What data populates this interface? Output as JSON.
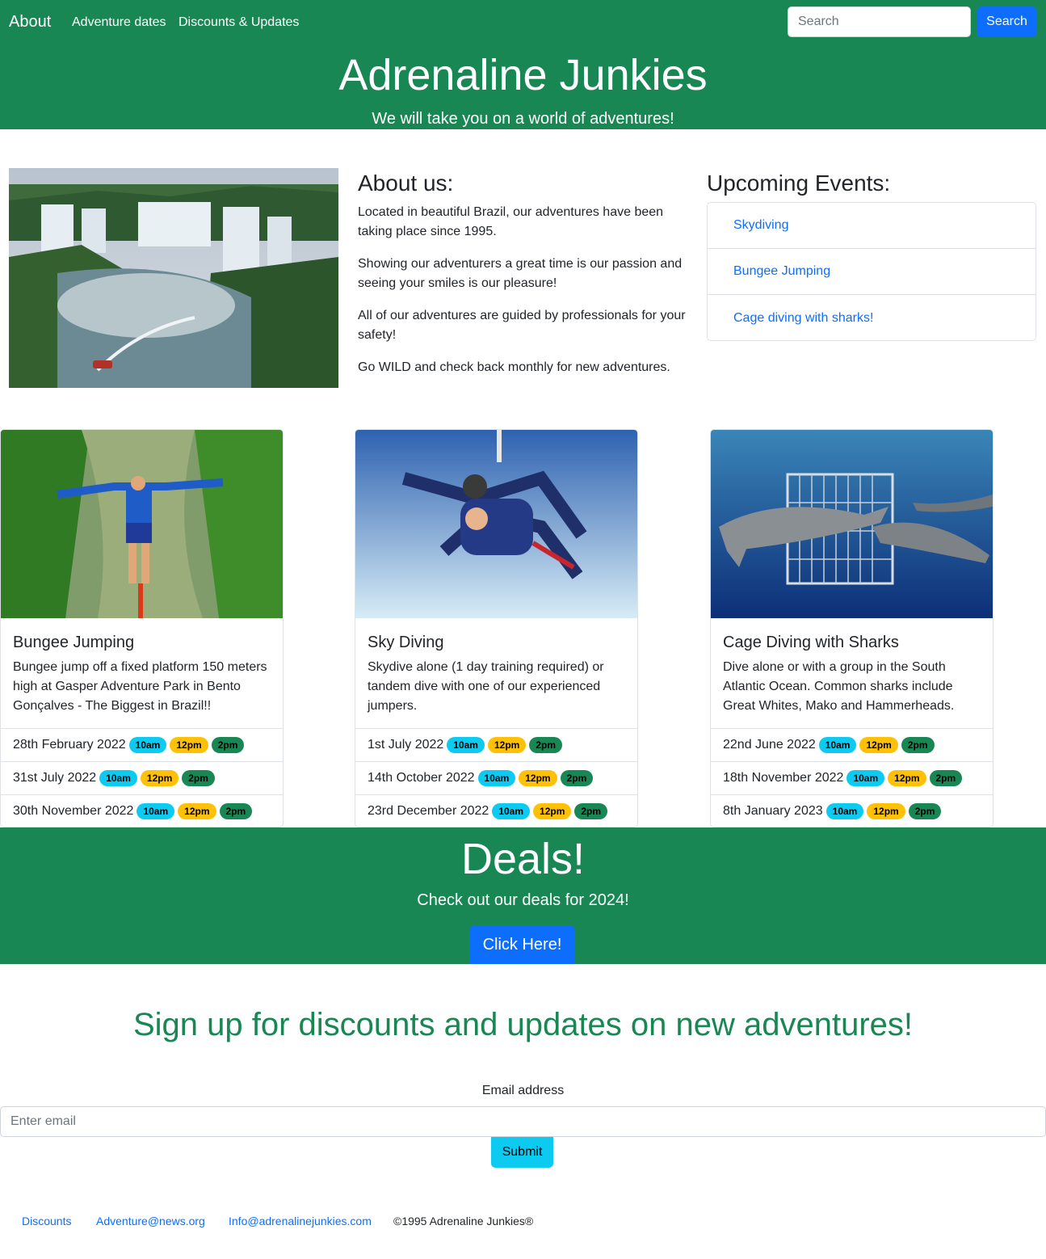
{
  "navbar": {
    "brand": "About",
    "links": [
      "Adventure dates",
      "Discounts & Updates"
    ],
    "search_placeholder": "Search",
    "search_button": "Search"
  },
  "hero": {
    "title": "Adrenaline Junkies",
    "tagline": "We will take you on a world of adventures!"
  },
  "about": {
    "heading": "About us:",
    "paragraphs": [
      "Located in beautiful Brazil, our adventures have been taking place since 1995.",
      "Showing our adventurers a great time is our passion and seeing your smiles is our pleasure!",
      "All of our adventures are guided by professionals for your safety!",
      "Go WILD and check back monthly for new adventures."
    ]
  },
  "events": {
    "heading": "Upcoming Events:",
    "items": [
      "Skydiving",
      "Bungee Jumping",
      "Cage diving with sharks!"
    ]
  },
  "time_badges": [
    "10am",
    "12pm",
    "2pm"
  ],
  "cards": [
    {
      "title": "Bungee Jumping",
      "text": "Bungee jump off a fixed platform 150 meters high at Gasper Adventure Park in Bento Gonçalves - The Biggest in Brazil!!",
      "dates": [
        "28th February 2022",
        "31st July 2022",
        "30th November 2022"
      ]
    },
    {
      "title": "Sky Diving",
      "text": "Skydive alone (1 day training required) or tandem dive with one of our experienced jumpers.",
      "dates": [
        "1st July 2022",
        "14th October 2022",
        "23rd December 2022"
      ]
    },
    {
      "title": "Cage Diving with Sharks",
      "text": "Dive alone or with a group in the South Atlantic Ocean. Common sharks include Great Whites, Mako and Hammerheads.",
      "dates": [
        "22nd June 2022",
        "18th November 2022",
        "8th January 2023"
      ]
    }
  ],
  "deals": {
    "title": "Deals!",
    "text": "Check out our deals for 2024!",
    "button": "Click Here!"
  },
  "signup": {
    "heading": "Sign up for discounts and updates on new adventures!",
    "email_label": "Email address",
    "email_placeholder": "Enter email",
    "submit": "Submit"
  },
  "footer": {
    "links": [
      "Discounts",
      "Adventure@news.org",
      "Info@adrenalinejunkies.com"
    ],
    "copyright": "©1995 Adrenaline Junkies®"
  },
  "colors": {
    "brand_green": "#198754",
    "primary_blue": "#0d6efd",
    "info_cyan": "#0dcaf0",
    "warning_yellow": "#ffc107"
  }
}
